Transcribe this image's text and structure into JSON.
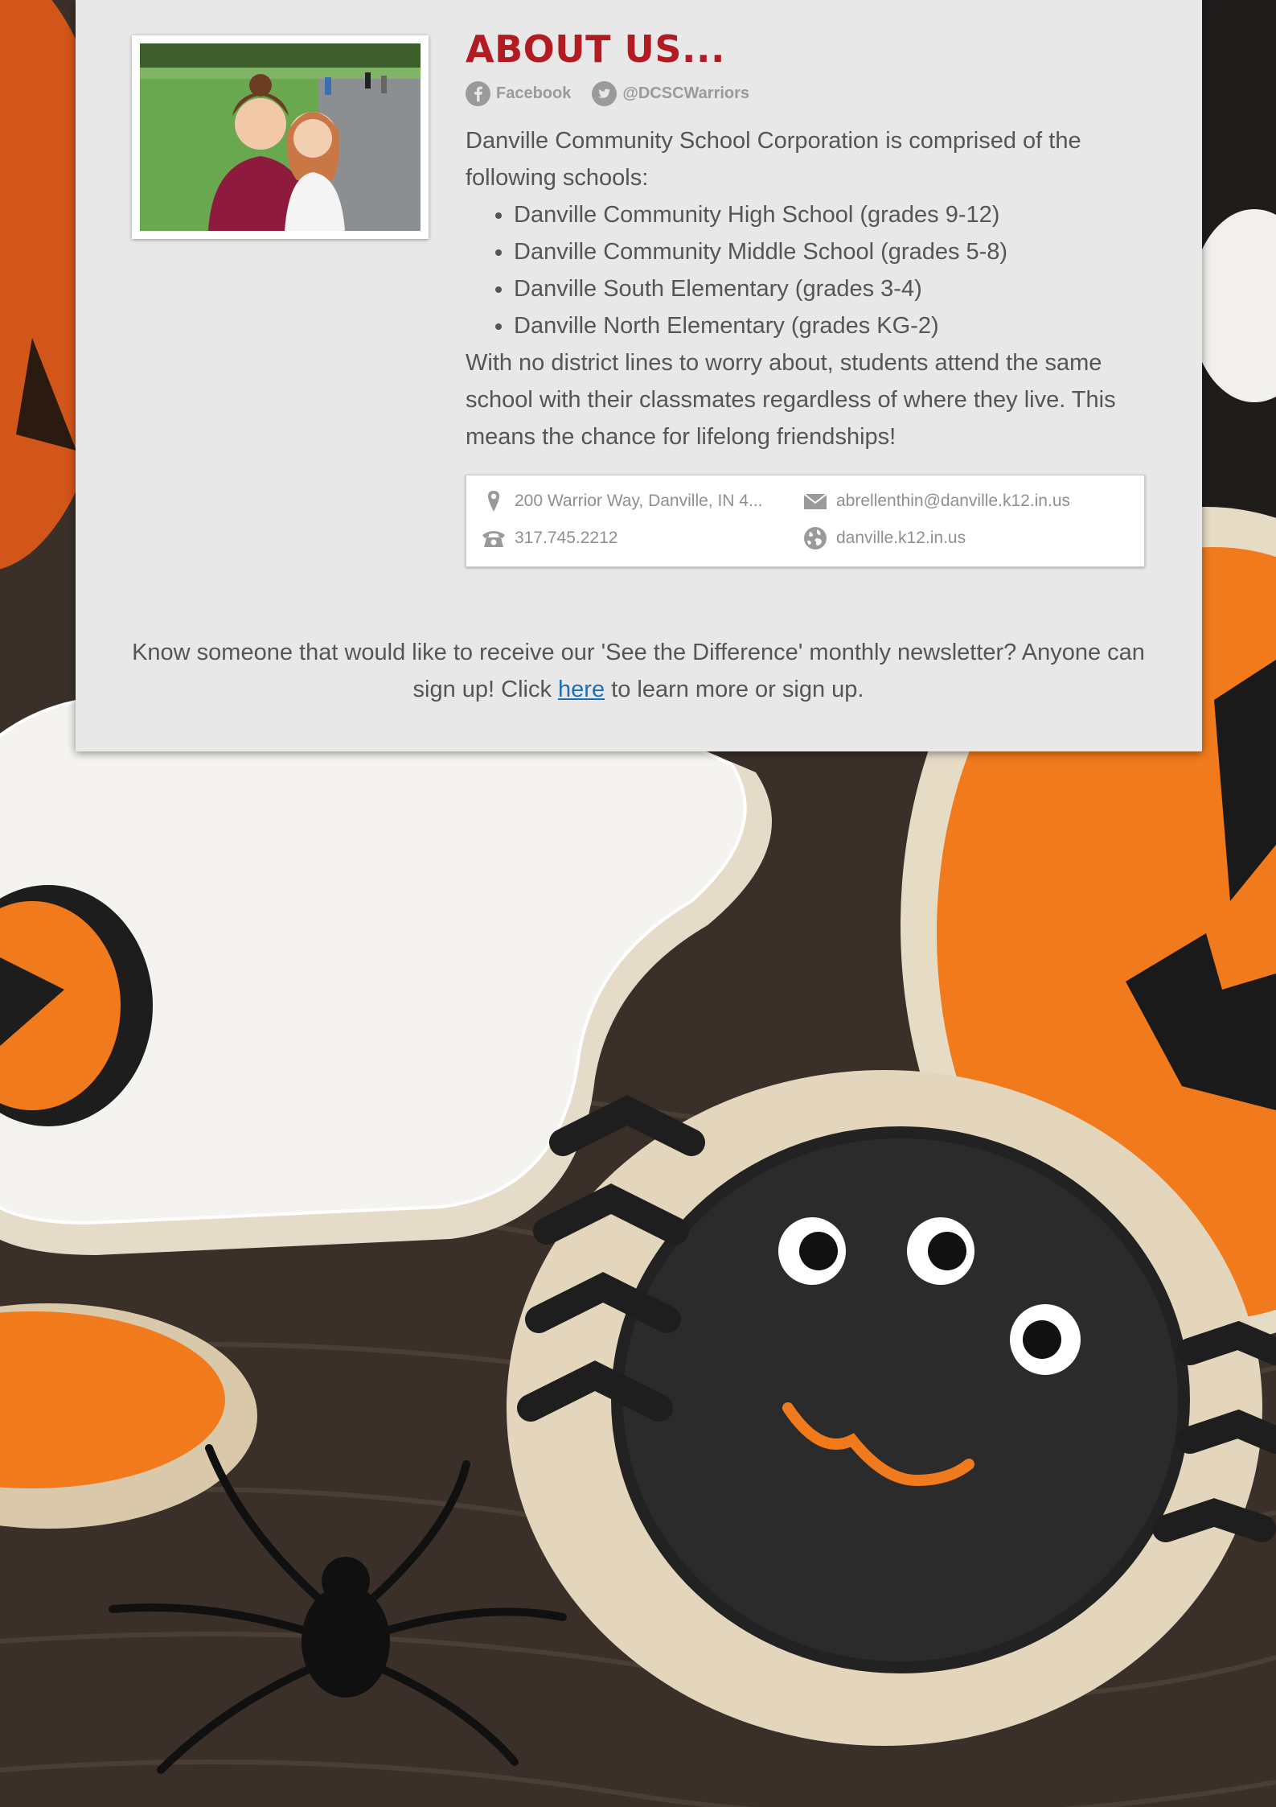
{
  "about": {
    "title": "ABOUT US...",
    "social": {
      "facebook_label": "Facebook",
      "twitter_label": "@DCSCWarriors"
    },
    "intro": "Danville Community School Corporation is comprised of the following schools:",
    "schools": [
      "Danville Community High School (grades 9-12)",
      "Danville Community Middle School (grades 5-8)",
      "Danville South Elementary (grades 3-4)",
      "Danville North Elementary (grades KG-2)"
    ],
    "outro": "With no district lines to worry about, students attend the same school with their classmates regardless of where they live. This means the chance for lifelong friendships!"
  },
  "contact": {
    "address": "200 Warrior Way, Danville, IN 4...",
    "email": "abrellenthin@danville.k12.in.us",
    "phone": "317.745.2212",
    "website": "danville.k12.in.us"
  },
  "newsletter": {
    "before_link": "Know someone that would like to receive our 'See the Difference' monthly newsletter? Anyone can sign up! Click ",
    "link_text": "here",
    "after_link": " to learn more or sign up."
  },
  "icons": {
    "facebook": "facebook-icon",
    "twitter": "twitter-icon",
    "address": "map-pin-icon",
    "email": "envelope-icon",
    "phone": "phone-icon",
    "website": "globe-icon"
  },
  "colors": {
    "title": "#b31b23",
    "card": "#e8e8e8",
    "link": "#1f6fb2",
    "body_text": "#555555"
  }
}
